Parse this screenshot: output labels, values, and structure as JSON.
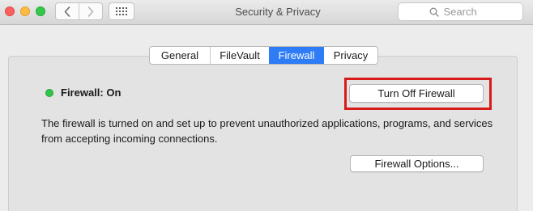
{
  "window": {
    "title": "Security & Privacy"
  },
  "toolbar": {
    "back_icon": "chevron-left-icon",
    "forward_icon": "chevron-right-icon",
    "show_all_icon": "grid-icon",
    "search_icon": "search-icon",
    "search_placeholder": "Search"
  },
  "tabs": [
    {
      "label": "General",
      "active": false
    },
    {
      "label": "FileVault",
      "active": false
    },
    {
      "label": "Firewall",
      "active": true
    },
    {
      "label": "Privacy",
      "active": false
    }
  ],
  "firewall": {
    "status_label": "Firewall: On",
    "status_color": "#31c54a",
    "turn_off_label": "Turn Off Firewall",
    "description": "The firewall is turned on and set up to prevent unauthorized applications, programs, and services from accepting incoming connections.",
    "options_label": "Firewall Options..."
  },
  "colors": {
    "accent": "#2e7cf6",
    "highlight": "#d71a1a"
  }
}
